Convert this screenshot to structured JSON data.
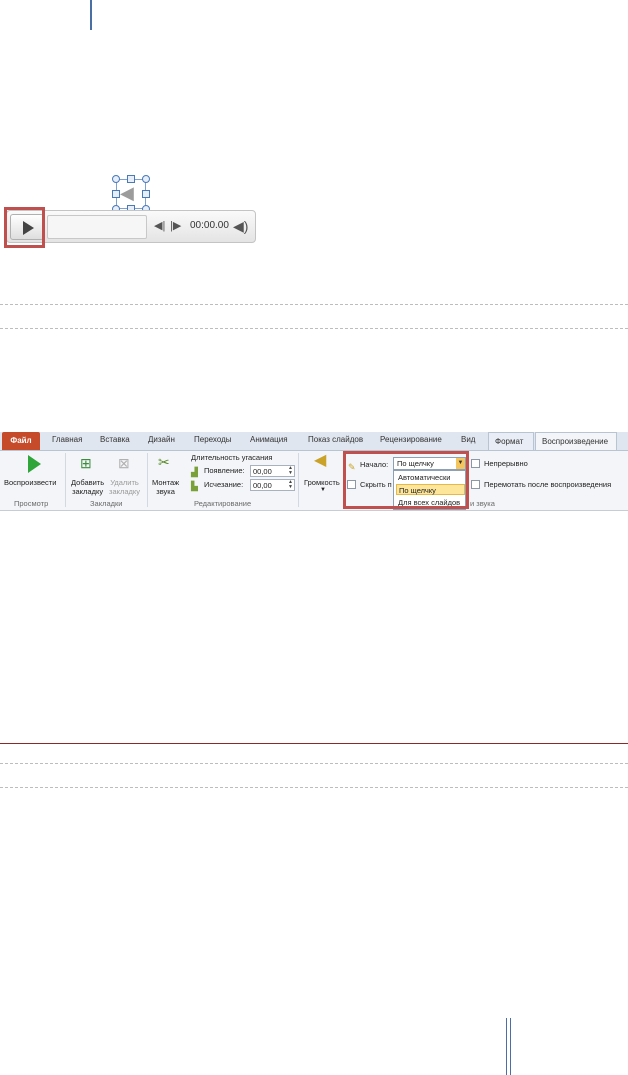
{
  "player": {
    "time": "00:00.00",
    "icons": [
      "speaker-icon",
      "play-icon",
      "skip-back-icon",
      "skip-forward-icon",
      "volume-icon"
    ]
  },
  "ribbon": {
    "tabs": [
      "Файл",
      "Главная",
      "Вставка",
      "Дизайн",
      "Переходы",
      "Анимация",
      "Показ слайдов",
      "Рецензирование",
      "Вид",
      "Формат",
      "Воспроизведение"
    ],
    "preview": {
      "play_label": "Воспроизвести",
      "group": "Просмотр"
    },
    "bookmarks": {
      "add_l1": "Добавить",
      "add_l2": "закладку",
      "remove_l1": "Удалить",
      "remove_l2": "закладку",
      "group": "Закладки"
    },
    "editing": {
      "trim_l1": "Монтаж",
      "trim_l2": "звука",
      "fade_title": "Длительность угасания",
      "fade_in_label": "Появление:",
      "fade_in_value": "00,00",
      "fade_out_label": "Исчезание:",
      "fade_out_value": "00,00",
      "group": "Редактирование"
    },
    "audio_options": {
      "volume_label": "Громкость",
      "start_label": "Начало:",
      "start_value": "По щелчку",
      "hide_label": "Скрыть п",
      "options": [
        "Автоматически",
        "По щелчку",
        "Для всех слайдов"
      ],
      "highlighted_option": "По щелчку",
      "group_tail": "и звука",
      "loop_label": "Непрерывно",
      "rewind_label": "Перемотать после воспроизведения"
    }
  },
  "colors": {
    "file_tab": "#c64b2a",
    "highlight_box": "#c0504d",
    "play_green": "#2fa53a",
    "dropdown_highlight": "#fde59a"
  }
}
